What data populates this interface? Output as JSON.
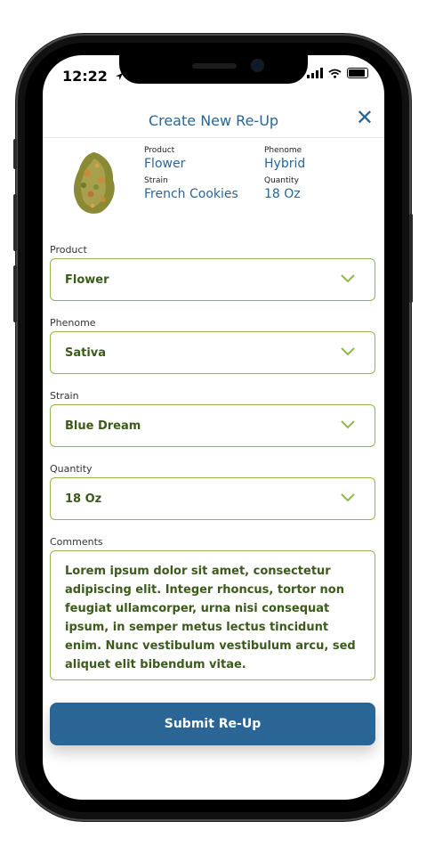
{
  "status_bar": {
    "time": "12:22"
  },
  "header": {
    "title": "Create New Re-Up",
    "close_glyph": "✕"
  },
  "summary": {
    "product_label": "Product",
    "product_value": "Flower",
    "phenome_label": "Phenome",
    "phenome_value": "Hybrid",
    "strain_label": "Strain",
    "strain_value": "French Cookies",
    "quantity_label": "Quantity",
    "quantity_value": "18 Oz"
  },
  "form": {
    "product": {
      "label": "Product",
      "value": "Flower"
    },
    "phenome": {
      "label": "Phenome",
      "value": "Sativa"
    },
    "strain": {
      "label": "Strain",
      "value": "Blue Dream"
    },
    "quantity": {
      "label": "Quantity",
      "value": "18 Oz"
    },
    "comments": {
      "label": "Comments",
      "value": "Lorem ipsum dolor sit amet, consectetur adipiscing elit. Integer rhoncus, tortor non feugiat ullamcorper, urna nisi consequat ipsum, in semper metus lectus tincidunt enim. Nunc vestibulum vestibulum arcu, sed aliquet elit bibendum vitae."
    }
  },
  "submit_label": "Submit Re-Up",
  "colors": {
    "primary": "#2a6596",
    "field_border": "#8fb74a",
    "field_text": "#3c5a1c"
  },
  "icons": [
    "location-arrow-icon",
    "cellular-signal-icon",
    "wifi-icon",
    "battery-icon",
    "close-icon",
    "chevron-down-icon"
  ]
}
